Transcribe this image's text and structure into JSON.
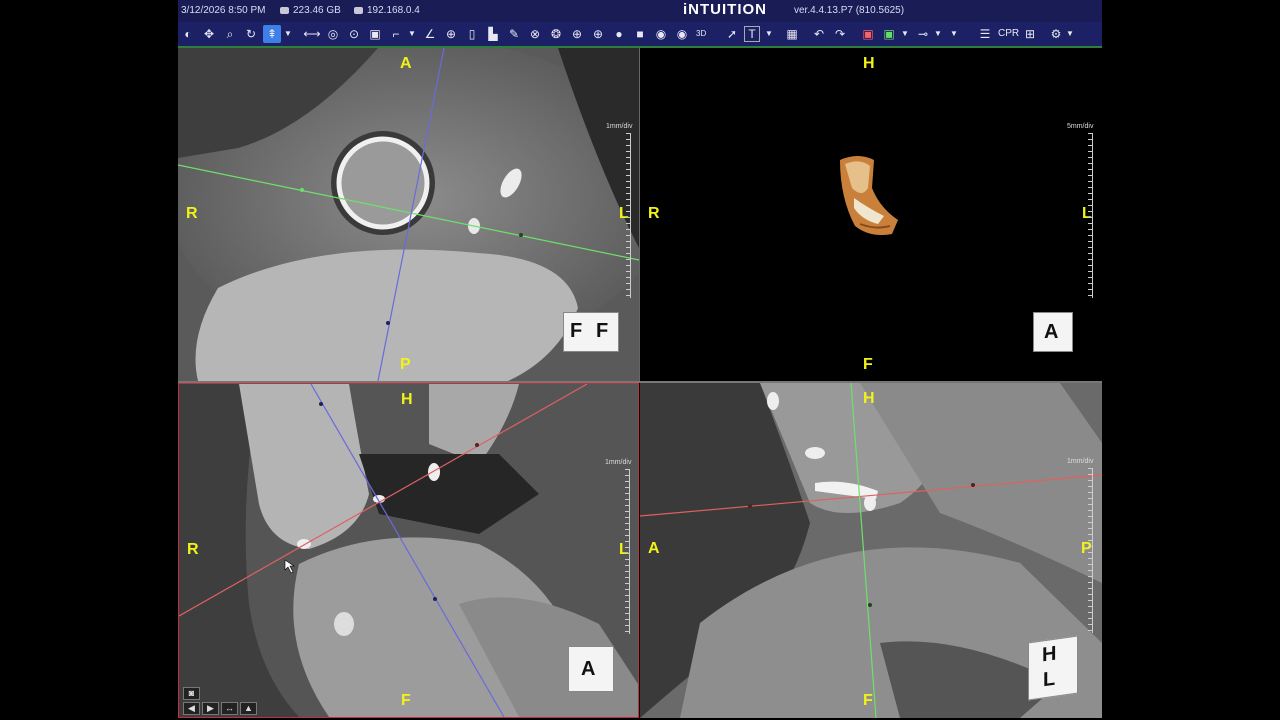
{
  "header": {
    "datetime": "3/12/2026  8:50 PM",
    "disk": "223.46 GB",
    "ip": "192.168.0.4",
    "brand": "iNTUITION",
    "version": "ver.4.4.13.P7 (810.5625)"
  },
  "toolbar": {
    "cpr_label": "CPR",
    "three_d_label": "3D",
    "text_tool_label": "T",
    "icons": [
      "contrast-icon",
      "pan-icon",
      "zoom-icon",
      "rotate-icon",
      "navigate-icon",
      "ruler-icon",
      "roi-circle-icon",
      "roi-target-icon",
      "snapshot-icon",
      "angle-icon",
      "angle-alt-icon",
      "crosshair-icon",
      "cylinder-icon",
      "histogram-icon",
      "sculpt-icon",
      "cut-icon",
      "segment-icon",
      "add-circle-icon",
      "add-circle-alt-icon",
      "sphere-icon",
      "cube-icon",
      "eye-icon",
      "eye-alt-icon",
      "three-d-icon",
      "pointer-icon",
      "text-tool-icon",
      "layout-icon",
      "undo-icon",
      "redo-icon",
      "image-color-icon",
      "green-square-icon",
      "link-icon",
      "list-icon",
      "plus-square-icon",
      "tree-icon"
    ]
  },
  "viewports": {
    "axial": {
      "top": "A",
      "bottom": "P",
      "left": "R",
      "right": "L",
      "scale": "1mm/div",
      "cube_face": "F",
      "cube_face2": "F"
    },
    "volume": {
      "top": "H",
      "bottom": "F",
      "left": "R",
      "right": "L",
      "scale": "5mm/div",
      "cube_face": "A"
    },
    "coronal": {
      "top": "H",
      "bottom": "F",
      "left": "R",
      "right": "L",
      "scale": "1mm/div",
      "cube_face": "A"
    },
    "sagittal": {
      "top": "H",
      "bottom": "F",
      "left": "A",
      "right": "P",
      "scale": "1mm/div",
      "cube_face": "H",
      "cube_face2": "L"
    }
  },
  "colors": {
    "header_bg": "#1a1d55",
    "toolbar_bg": "#1c2064",
    "orientation_label": "#f2f21a",
    "crosshair_green": "#6fe06a",
    "crosshair_red": "#e06060",
    "crosshair_blue": "#6a6adc",
    "active_border": "#c0303a"
  }
}
